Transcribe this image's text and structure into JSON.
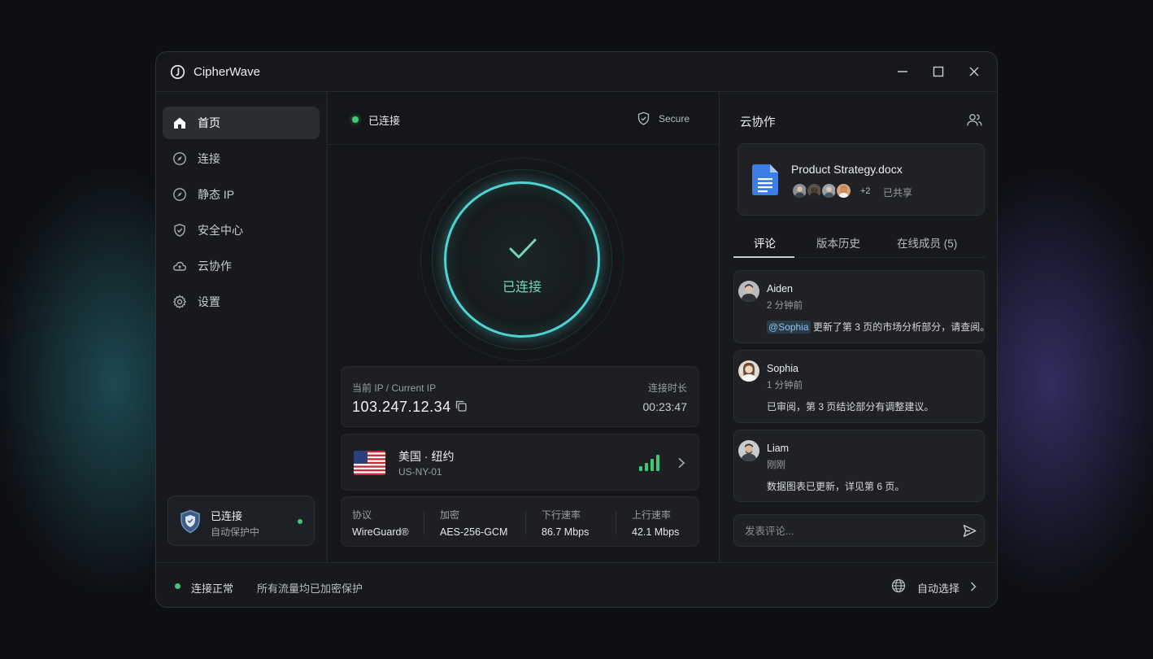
{
  "app": {
    "title": "CipherWave"
  },
  "sidebar": {
    "items": [
      {
        "label": "首页",
        "icon": "home-icon",
        "active": true
      },
      {
        "label": "连接",
        "icon": "compass-icon",
        "active": false
      },
      {
        "label": "静态 IP",
        "icon": "pin-icon",
        "active": false
      },
      {
        "label": "安全中心",
        "icon": "shield-icon",
        "active": false
      },
      {
        "label": "云协作",
        "icon": "cloud-icon",
        "active": false
      },
      {
        "label": "设置",
        "icon": "gear-icon",
        "active": false
      }
    ],
    "status": {
      "title": "已连接",
      "subtitle": "自动保护中"
    }
  },
  "main": {
    "status_label": "已连接",
    "secure_label": "Secure",
    "ring_label": "已连接",
    "ip": {
      "label": "当前 IP / Current IP",
      "value": "103.247.12.34",
      "duration_label": "连接时长",
      "duration": "00:23:47"
    },
    "location": {
      "name": "美国 · 纽约",
      "code": "US-NY-01"
    },
    "stats": [
      {
        "label": "协议",
        "value": "WireGuard®"
      },
      {
        "label": "加密",
        "value": "AES-256-GCM"
      },
      {
        "label": "下行速率",
        "value": "86.7 Mbps"
      },
      {
        "label": "上行速率",
        "value": "42.1 Mbps"
      }
    ]
  },
  "collab": {
    "title": "云协作",
    "document": {
      "name": "Product Strategy.docx",
      "more": "+2",
      "shared": "已共享"
    },
    "tabs": [
      {
        "label": "评论",
        "active": true
      },
      {
        "label": "版本历史",
        "active": false
      },
      {
        "label": "在线成员 (5)",
        "active": false
      }
    ],
    "comments": [
      {
        "name": "Aiden",
        "time": "2 分钟前",
        "mention": "@Sophia",
        "text": "更新了第 3 页的市场分析部分，请查阅。"
      },
      {
        "name": "Sophia",
        "time": "1 分钟前",
        "mention": "",
        "text": "已审阅，第 3 页结论部分有调整建议。"
      },
      {
        "name": "Liam",
        "time": "刚刚",
        "mention": "",
        "text": "数据图表已更新，详见第 6 页。"
      }
    ],
    "input_placeholder": "发表评论..."
  },
  "footer": {
    "status": "连接正常",
    "message": "所有流量均已加密保护",
    "mode": "自动选择"
  },
  "colors": {
    "accent": "#4fd4d2",
    "connected": "#3fc77a",
    "background": "#16181c"
  }
}
